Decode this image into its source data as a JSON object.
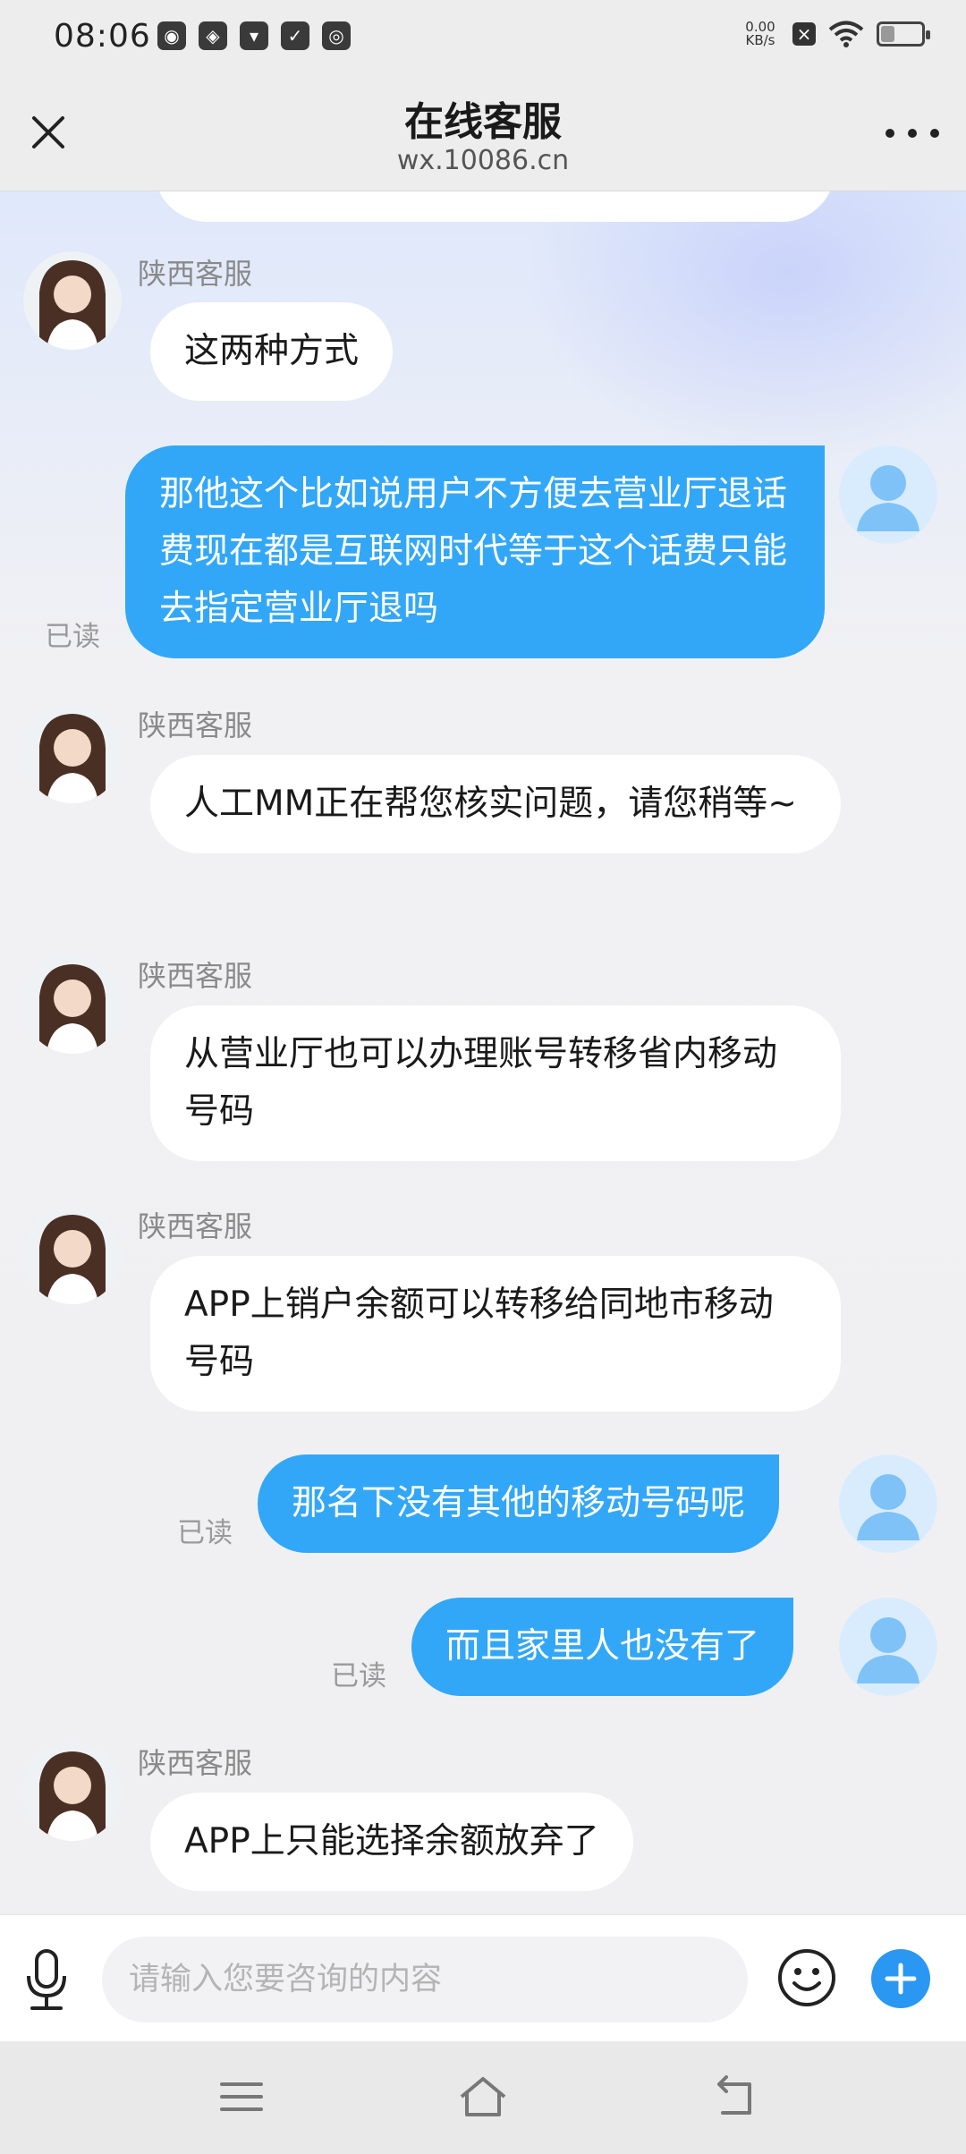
{
  "status_bar": {
    "time": "08:06",
    "net_speed_value": "0.00",
    "net_speed_unit": "KB/s",
    "notification_icons": [
      "wechat-icon",
      "app-icon",
      "mail-icon",
      "shield-icon",
      "circle-app-icon"
    ],
    "battery_level": 0.35
  },
  "header": {
    "title": "在线客服",
    "subtitle": "wx.10086.cn"
  },
  "chat": {
    "messages": [
      {
        "from": "agent",
        "name": "陕西客服",
        "text": "这两种方式"
      },
      {
        "from": "user",
        "text": "那他这个比如说用户不方便去营业厅退话费现在都是互联网时代等于这个话费只能去指定营业厅退吗",
        "read": "已读"
      },
      {
        "from": "agent",
        "name": "陕西客服",
        "text": "人工MM正在帮您核实问题，请您稍等~"
      },
      {
        "from": "agent",
        "name": "陕西客服",
        "text": "从营业厅也可以办理账号转移省内移动号码"
      },
      {
        "from": "agent",
        "name": "陕西客服",
        "text": "APP上销户余额可以转移给同地市移动号码"
      },
      {
        "from": "user",
        "text": "那名下没有其他的移动号码呢",
        "read": "已读"
      },
      {
        "from": "user",
        "text": "而且家里人也没有了",
        "read": "已读"
      },
      {
        "from": "agent",
        "name": "陕西客服",
        "text": "APP上只能选择余额放弃了"
      }
    ]
  },
  "input": {
    "placeholder": "请输入您要咨询的内容",
    "value": ""
  },
  "colors": {
    "user_bubble": "#33a7f7",
    "send_plus": "#2a97f2"
  }
}
